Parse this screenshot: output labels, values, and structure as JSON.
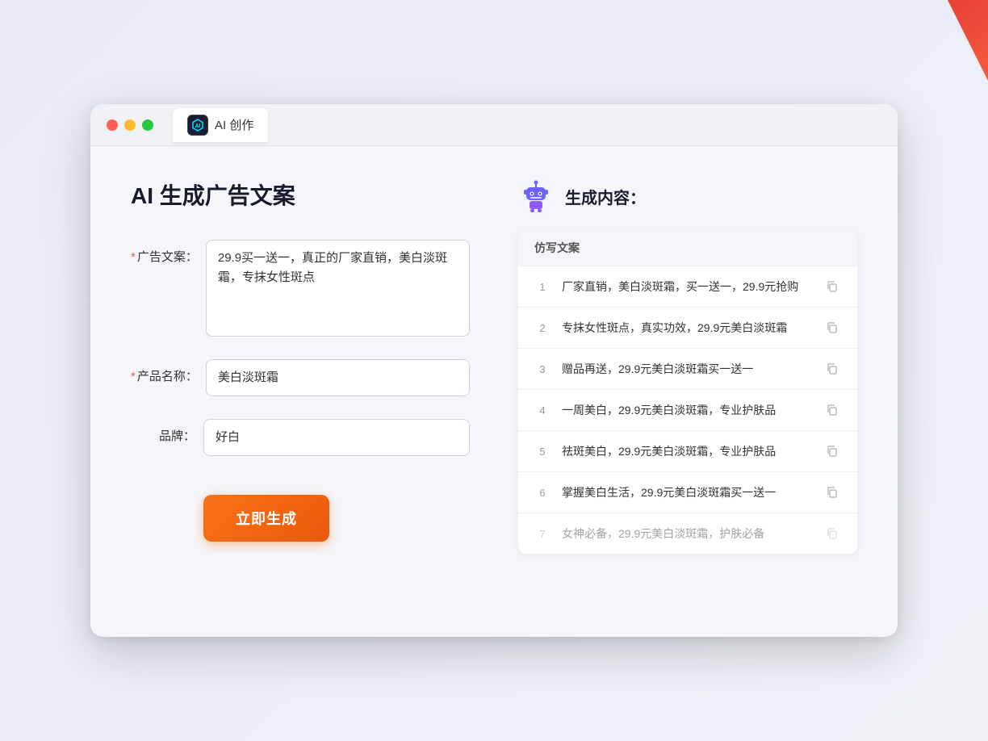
{
  "window": {
    "tab_label": "AI 创作"
  },
  "page": {
    "title": "AI 生成广告文案"
  },
  "form": {
    "ad_copy_label": "广告文案：",
    "ad_copy_required": "*",
    "ad_copy_value": "29.9买一送一，真正的厂家直销，美白淡斑霜，专抹女性斑点",
    "product_name_label": "产品名称：",
    "product_name_required": "*",
    "product_name_value": "美白淡斑霜",
    "brand_label": "品牌：",
    "brand_value": "好白",
    "generate_btn_label": "立即生成"
  },
  "result": {
    "header_title": "生成内容：",
    "table_column": "仿写文案",
    "items": [
      {
        "num": "1",
        "text": "厂家直销，美白淡斑霜，买一送一，29.9元抢购",
        "faded": false
      },
      {
        "num": "2",
        "text": "专抹女性斑点，真实功效，29.9元美白淡斑霜",
        "faded": false
      },
      {
        "num": "3",
        "text": "赠品再送，29.9元美白淡斑霜买一送一",
        "faded": false
      },
      {
        "num": "4",
        "text": "一周美白，29.9元美白淡斑霜，专业护肤品",
        "faded": false
      },
      {
        "num": "5",
        "text": "祛斑美白，29.9元美白淡斑霜，专业护肤品",
        "faded": false
      },
      {
        "num": "6",
        "text": "掌握美白生活，29.9元美白淡斑霜买一送一",
        "faded": false
      },
      {
        "num": "7",
        "text": "女神必备，29.9元美白淡斑霜，护肤必备",
        "faded": true
      }
    ]
  },
  "colors": {
    "accent": "#f97316",
    "primary": "#5b6af0",
    "text_dark": "#1a1a2e",
    "text_muted": "#999"
  }
}
